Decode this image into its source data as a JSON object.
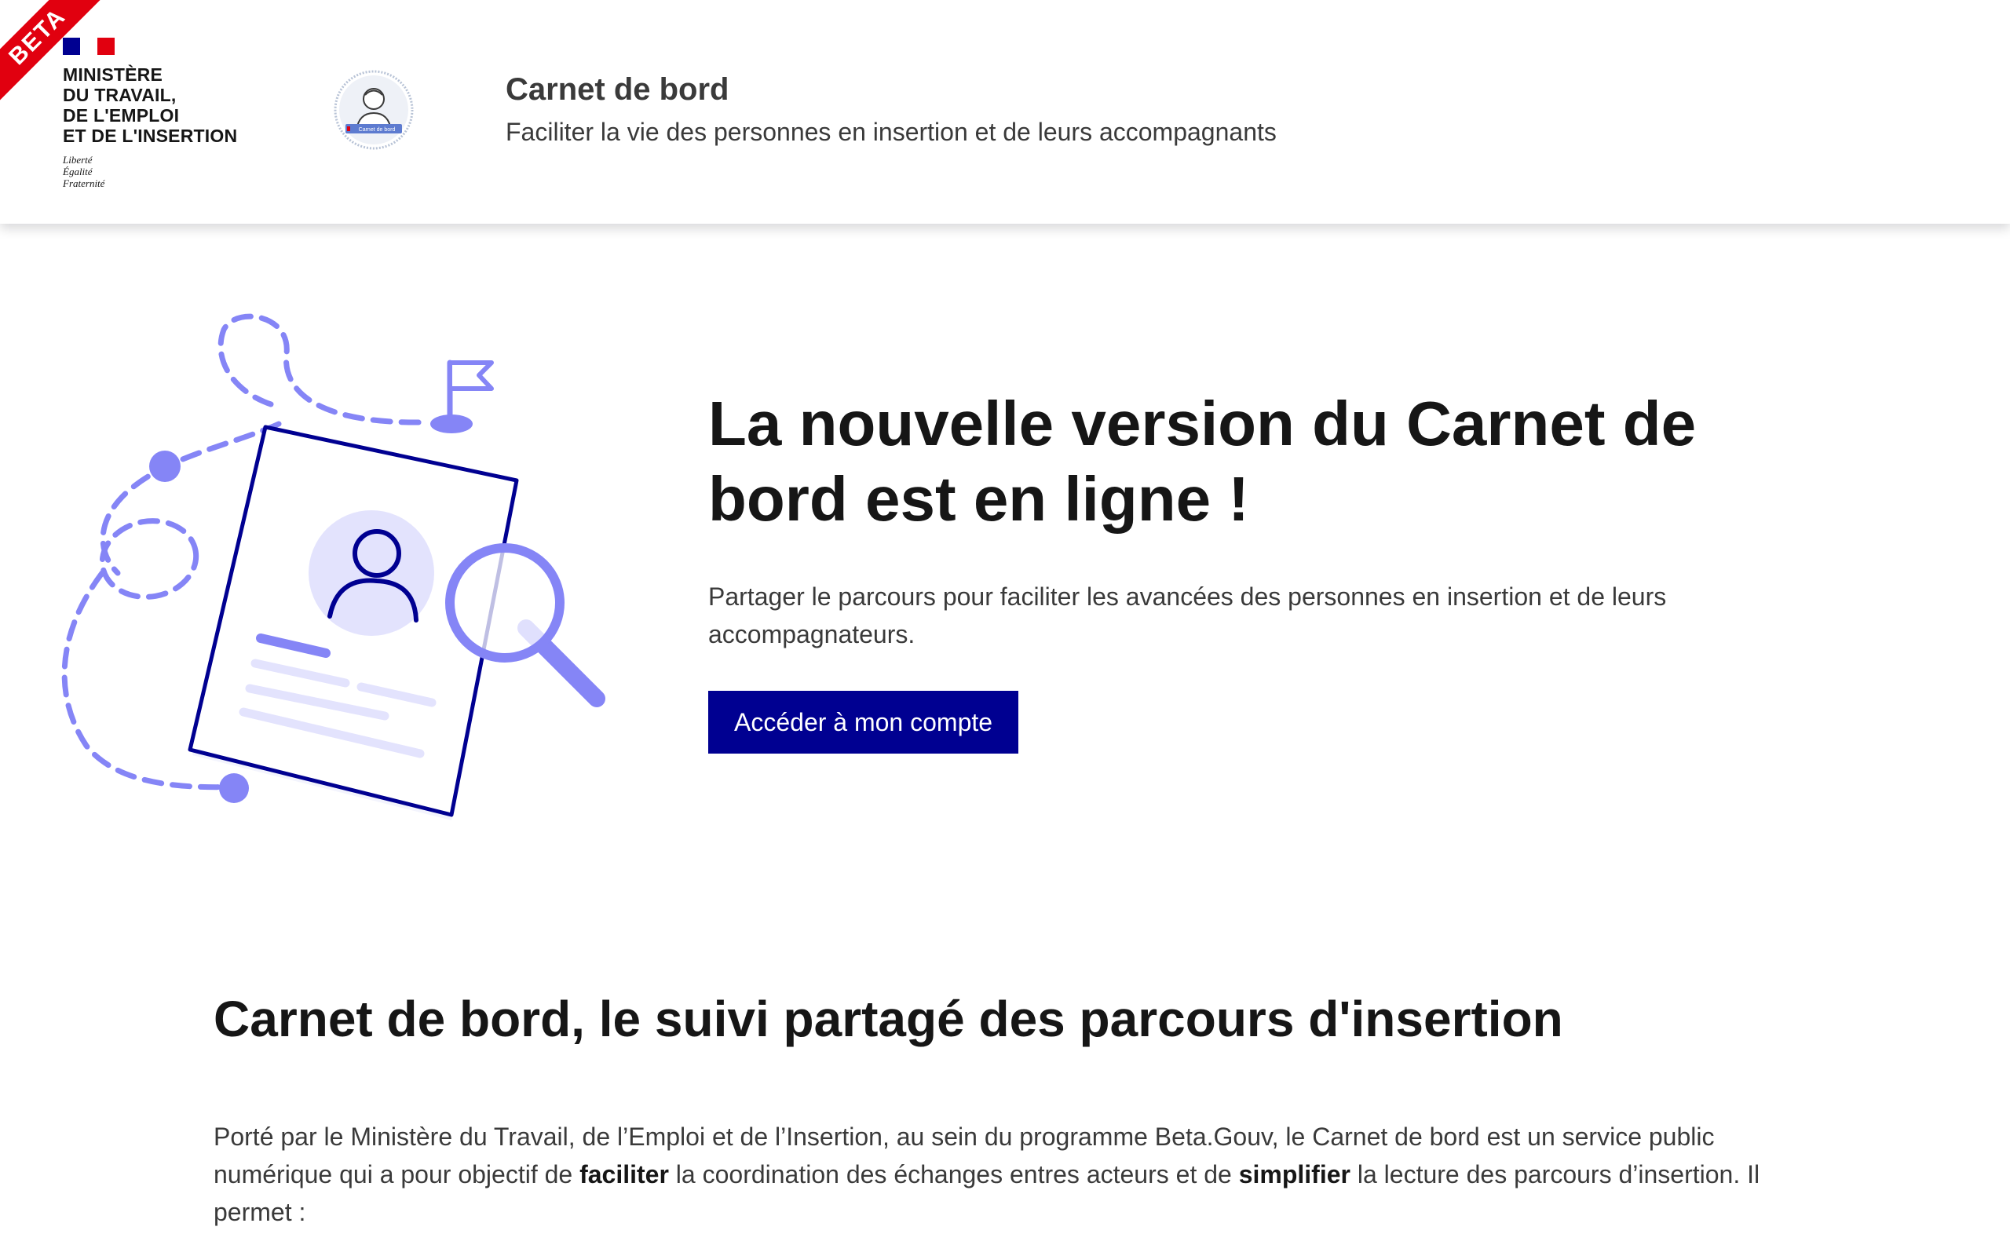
{
  "header": {
    "beta_badge": "BETA",
    "ministry": "MINISTÈRE\nDU TRAVAIL,\nDE L'EMPLOI\nET DE L'INSERTION",
    "motto": "Liberté\nÉgalité\nFraternité",
    "service_logo_text": "Carnet de bord",
    "service_title": "Carnet de bord",
    "service_tagline": "Faciliter la vie des personnes en insertion et de leurs accompagnants"
  },
  "hero": {
    "title": "La nouvelle version du Carnet de bord est en ligne !",
    "text": "Partager le parcours pour faciliter les avancées des personnes en insertion et de leurs accompagnateurs.",
    "button_label": "Accéder à mon compte",
    "illustration_icons": [
      "dashed-path-icon",
      "flag-icon",
      "profile-document-icon",
      "magnifier-icon"
    ]
  },
  "section": {
    "title": "Carnet de bord, le suivi partagé des parcours d'insertion",
    "intro_part1": "Porté par le Ministère du Travail, de l’Emploi et de l’Insertion, au sein du programme Beta.Gouv, le Carnet de bord est un service public numérique qui a pour objectif de ",
    "intro_bold1": "faciliter",
    "intro_part2": " la coordination des échanges entres acteurs et de ",
    "intro_bold2": "simplifier",
    "intro_part3": " la lecture des parcours d’insertion. Il permet :"
  },
  "colors": {
    "primary": "#000091",
    "beta_red": "#e1000f",
    "illustration_lilac": "#8585f6",
    "illustration_light": "#e3e3fd",
    "text_dark": "#161616",
    "text_grey": "#3a3a3a"
  }
}
